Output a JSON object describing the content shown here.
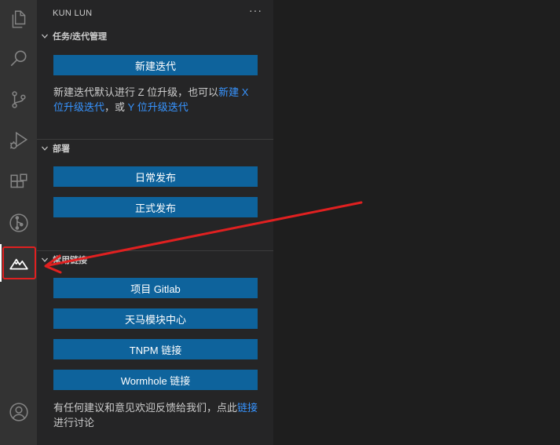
{
  "sidebar": {
    "title": "KUN LUN",
    "more": "···",
    "sections": {
      "tasks": {
        "heading": "任务/迭代管理",
        "button": "新建迭代",
        "text_before": "新建迭代默认进行 Z 位升级，也可以",
        "link_x": "新建 X 位升级迭代",
        "text_mid": "，或 ",
        "link_y": "Y 位升级迭代"
      },
      "deploy": {
        "heading": "部署",
        "buttons": [
          "日常发布",
          "正式发布"
        ]
      },
      "links": {
        "heading": "常用链接",
        "buttons": [
          "项目 Gitlab",
          "天马模块中心",
          "TNPM 链接",
          "Wormhole 链接"
        ],
        "feedback_text": "有任何建议和意见欢迎反馈给我们，点此",
        "feedback_link": "链接",
        "feedback_tail": "进行讨论"
      }
    }
  },
  "activity_bar": {
    "icons": [
      "files-icon",
      "search-icon",
      "source-control-icon",
      "run-debug-icon",
      "extensions-icon",
      "git-graph-icon",
      "kunlun-mountain-icon",
      "account-icon"
    ],
    "active": "kunlun-mountain-icon"
  },
  "colors": {
    "button": "#0e639c",
    "link": "#3794ff",
    "annotation": "#e02020"
  }
}
